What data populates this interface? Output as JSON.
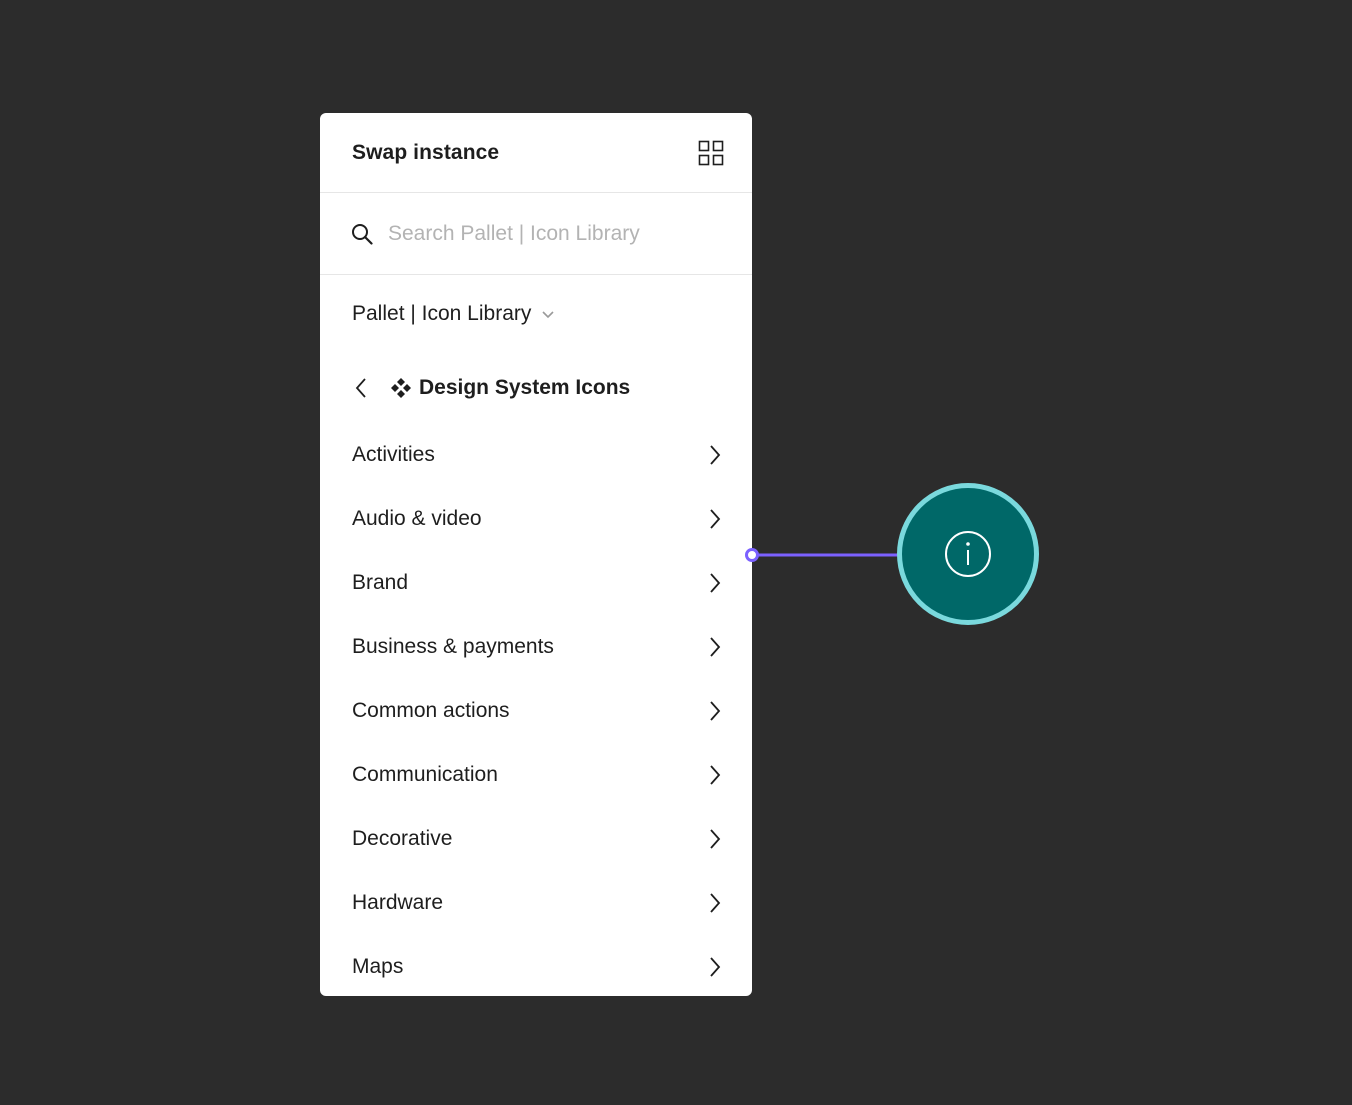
{
  "panel": {
    "title": "Swap instance",
    "grid_icon": "grid-view-icon"
  },
  "search": {
    "icon": "search-icon",
    "placeholder": "Search Pallet | Icon Library",
    "value": ""
  },
  "library": {
    "label": "Pallet | Icon Library",
    "icon": "chevron-down-icon"
  },
  "breadcrumb": {
    "back_icon": "chevron-left-icon",
    "component_icon": "component-icon",
    "title": "Design System Icons"
  },
  "categories": [
    {
      "label": "Activities"
    },
    {
      "label": "Audio & video"
    },
    {
      "label": "Brand"
    },
    {
      "label": "Business & payments"
    },
    {
      "label": "Common actions"
    },
    {
      "label": "Communication"
    },
    {
      "label": "Decorative"
    },
    {
      "label": "Hardware"
    },
    {
      "label": "Maps"
    }
  ],
  "annotation": {
    "icon": "info-icon",
    "connector_color": "#7b61ff",
    "badge_fill": "#006868",
    "badge_ring": "#7ad9dd"
  }
}
